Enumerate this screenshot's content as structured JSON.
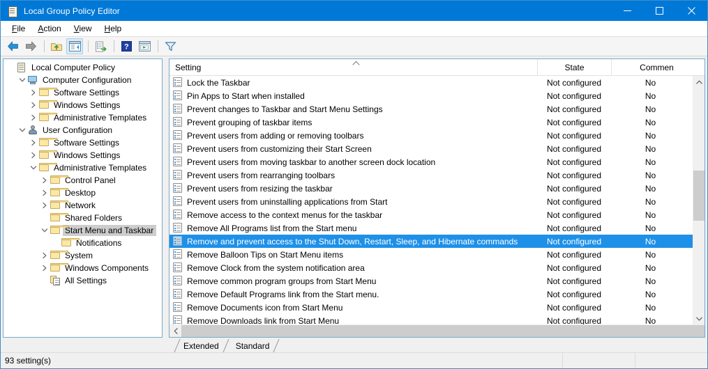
{
  "window": {
    "title": "Local Group Policy Editor",
    "icon": "console-root-icon",
    "controls": [
      {
        "name": "minimize-button",
        "glyph": "minimize-icon"
      },
      {
        "name": "maximize-button",
        "glyph": "maximize-icon"
      },
      {
        "name": "close-button",
        "glyph": "close-icon"
      }
    ]
  },
  "menubar": {
    "items": [
      {
        "label": "File",
        "accel": "F"
      },
      {
        "label": "Action",
        "accel": "A"
      },
      {
        "label": "View",
        "accel": "V"
      },
      {
        "label": "Help",
        "accel": "H"
      }
    ]
  },
  "toolbar": {
    "buttons": [
      {
        "name": "back-button",
        "icon": "back-arrow-icon",
        "enabled": true
      },
      {
        "name": "forward-button",
        "icon": "forward-arrow-icon",
        "enabled": false
      },
      {
        "name": "up-one-level-button",
        "icon": "folder-up-icon",
        "enabled": true
      },
      {
        "name": "show-hide-console-tree-button",
        "icon": "console-tree-icon",
        "enabled": true,
        "active": true
      },
      {
        "name": "export-list-button",
        "icon": "export-list-icon",
        "enabled": true
      },
      {
        "name": "help-button",
        "icon": "help-question-icon",
        "enabled": true
      },
      {
        "name": "properties-button",
        "icon": "properties-window-icon",
        "enabled": true
      },
      {
        "name": "filter-button",
        "icon": "filter-funnel-icon",
        "enabled": true
      }
    ]
  },
  "tree": {
    "items": [
      {
        "label": "Local Computer Policy",
        "depth": 0,
        "icon": "console-root-icon",
        "expander": "none",
        "selected": false
      },
      {
        "label": "Computer Configuration",
        "depth": 1,
        "icon": "computer-icon",
        "expander": "expanded",
        "selected": false
      },
      {
        "label": "Software Settings",
        "depth": 2,
        "icon": "folder-icon",
        "expander": "collapsed",
        "selected": false
      },
      {
        "label": "Windows Settings",
        "depth": 2,
        "icon": "folder-icon",
        "expander": "collapsed",
        "selected": false
      },
      {
        "label": "Administrative Templates",
        "depth": 2,
        "icon": "folder-icon",
        "expander": "collapsed",
        "selected": false
      },
      {
        "label": "User Configuration",
        "depth": 1,
        "icon": "user-icon",
        "expander": "expanded",
        "selected": false
      },
      {
        "label": "Software Settings",
        "depth": 2,
        "icon": "folder-icon",
        "expander": "collapsed",
        "selected": false
      },
      {
        "label": "Windows Settings",
        "depth": 2,
        "icon": "folder-icon",
        "expander": "collapsed",
        "selected": false
      },
      {
        "label": "Administrative Templates",
        "depth": 2,
        "icon": "folder-icon",
        "expander": "expanded",
        "selected": false
      },
      {
        "label": "Control Panel",
        "depth": 3,
        "icon": "folder-icon",
        "expander": "collapsed",
        "selected": false
      },
      {
        "label": "Desktop",
        "depth": 3,
        "icon": "folder-icon",
        "expander": "collapsed",
        "selected": false
      },
      {
        "label": "Network",
        "depth": 3,
        "icon": "folder-icon",
        "expander": "collapsed",
        "selected": false
      },
      {
        "label": "Shared Folders",
        "depth": 3,
        "icon": "folder-icon",
        "expander": "none",
        "selected": false
      },
      {
        "label": "Start Menu and Taskbar",
        "depth": 3,
        "icon": "folder-icon",
        "expander": "expanded",
        "selected": true
      },
      {
        "label": "Notifications",
        "depth": 4,
        "icon": "folder-icon",
        "expander": "none",
        "selected": false
      },
      {
        "label": "System",
        "depth": 3,
        "icon": "folder-icon",
        "expander": "collapsed",
        "selected": false
      },
      {
        "label": "Windows Components",
        "depth": 3,
        "icon": "folder-icon",
        "expander": "collapsed",
        "selected": false
      },
      {
        "label": "All Settings",
        "depth": 3,
        "icon": "all-settings-icon",
        "expander": "none",
        "selected": false
      }
    ]
  },
  "list": {
    "columns": [
      {
        "key": "setting",
        "label": "Setting",
        "sorted": "ascending"
      },
      {
        "key": "state",
        "label": "State"
      },
      {
        "key": "comment",
        "label": "Commen"
      }
    ],
    "rows": [
      {
        "setting": "Lock the Taskbar",
        "state": "Not configured",
        "comment": "No",
        "selected": false
      },
      {
        "setting": "Pin Apps to Start when installed",
        "state": "Not configured",
        "comment": "No",
        "selected": false
      },
      {
        "setting": "Prevent changes to Taskbar and Start Menu Settings",
        "state": "Not configured",
        "comment": "No",
        "selected": false
      },
      {
        "setting": "Prevent grouping of taskbar items",
        "state": "Not configured",
        "comment": "No",
        "selected": false
      },
      {
        "setting": "Prevent users from adding or removing toolbars",
        "state": "Not configured",
        "comment": "No",
        "selected": false
      },
      {
        "setting": "Prevent users from customizing their Start Screen",
        "state": "Not configured",
        "comment": "No",
        "selected": false
      },
      {
        "setting": "Prevent users from moving taskbar to another screen dock location",
        "state": "Not configured",
        "comment": "No",
        "selected": false
      },
      {
        "setting": "Prevent users from rearranging toolbars",
        "state": "Not configured",
        "comment": "No",
        "selected": false
      },
      {
        "setting": "Prevent users from resizing the taskbar",
        "state": "Not configured",
        "comment": "No",
        "selected": false
      },
      {
        "setting": "Prevent users from uninstalling applications from Start",
        "state": "Not configured",
        "comment": "No",
        "selected": false
      },
      {
        "setting": "Remove access to the context menus for the taskbar",
        "state": "Not configured",
        "comment": "No",
        "selected": false
      },
      {
        "setting": "Remove All Programs list from the Start menu",
        "state": "Not configured",
        "comment": "No",
        "selected": false
      },
      {
        "setting": "Remove and prevent access to the Shut Down, Restart, Sleep, and Hibernate commands",
        "state": "Not configured",
        "comment": "No",
        "selected": true
      },
      {
        "setting": "Remove Balloon Tips on Start Menu items",
        "state": "Not configured",
        "comment": "No",
        "selected": false
      },
      {
        "setting": "Remove Clock from the system notification area",
        "state": "Not configured",
        "comment": "No",
        "selected": false
      },
      {
        "setting": "Remove common program groups from Start Menu",
        "state": "Not configured",
        "comment": "No",
        "selected": false
      },
      {
        "setting": "Remove Default Programs link from the Start menu.",
        "state": "Not configured",
        "comment": "No",
        "selected": false
      },
      {
        "setting": "Remove Documents icon from Start Menu",
        "state": "Not configured",
        "comment": "No",
        "selected": false
      },
      {
        "setting": "Remove Downloads link from Start Menu",
        "state": "Not configured",
        "comment": "No",
        "selected": false
      }
    ]
  },
  "tabs": [
    {
      "label": "Extended",
      "active": false
    },
    {
      "label": "Standard",
      "active": true
    }
  ],
  "statusbar": {
    "text": "93 setting(s)"
  },
  "colors": {
    "titlebar": "#0078d7",
    "selection": "#1e90e8",
    "tree_selection": "#cdcdcd",
    "window_bg": "#f0f0f0",
    "border": "#7aa9c7"
  }
}
